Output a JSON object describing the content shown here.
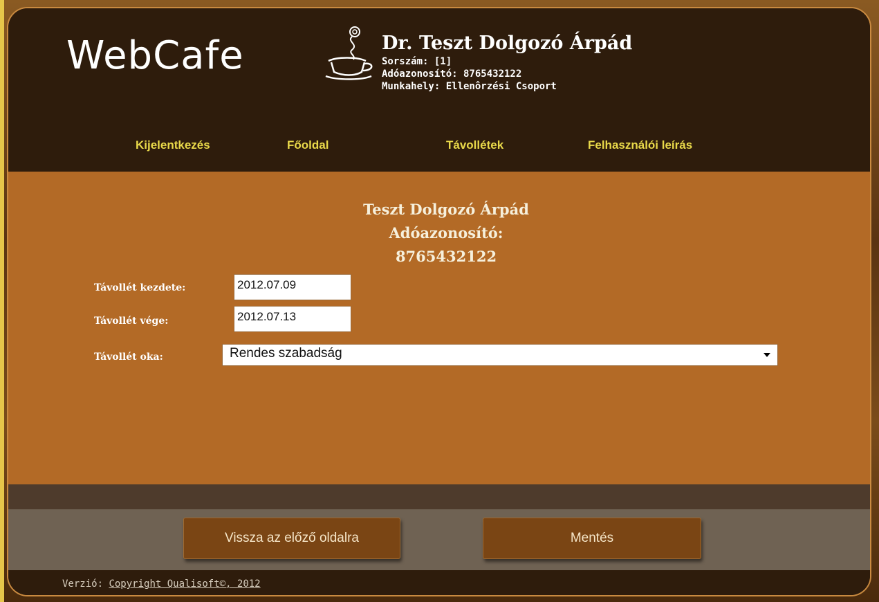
{
  "brand": {
    "logo_text": "WebCafe"
  },
  "user": {
    "name": "Dr. Teszt Dolgozó Árpád",
    "sorszam": "Sorszám: [1]",
    "adoazonosito": "Adóazonosító: 8765432122",
    "munkahely": "Munkahely: Ellenôrzési Csoport"
  },
  "nav": {
    "items": [
      {
        "label": "Kijelentkezés"
      },
      {
        "label": "Főoldal"
      },
      {
        "label": "Távollétek"
      },
      {
        "label": "Felhasználói leírás"
      }
    ]
  },
  "employee": {
    "name": "Teszt Dolgozó Árpád",
    "tax_label": "Adóazonosító:",
    "tax_value": "8765432122"
  },
  "form": {
    "start_label": "Távollét kezdete:",
    "start_value": "2012.07.09",
    "end_label": "Távollét vége:",
    "end_value": "2012.07.13",
    "reason_label": "Távollét oka:",
    "reason_value": "Rendes szabadság"
  },
  "actions": {
    "back_label": "Vissza az előző oldalra",
    "save_label": "Mentés"
  },
  "footer": {
    "version_label": "Verzió:",
    "copyright": "Copyright Qualisoft©, 2012"
  },
  "colors": {
    "header_bg": "#2e1c0c",
    "main_bg": "#b36a26",
    "nav_link": "#e9d94a",
    "button_bg": "#7a4514"
  }
}
